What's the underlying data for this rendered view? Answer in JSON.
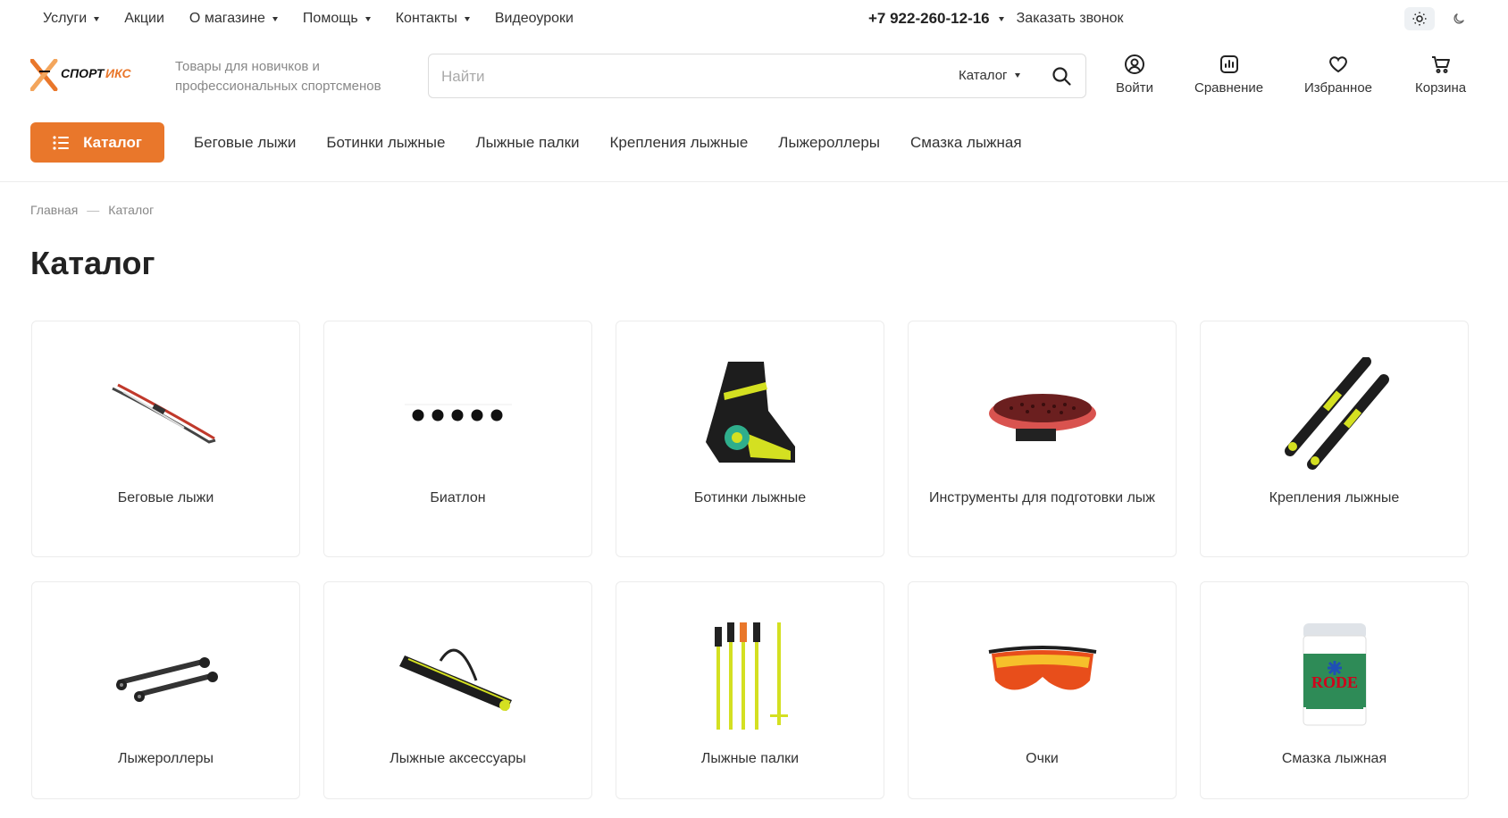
{
  "topnav": {
    "items": [
      {
        "label": "Услуги",
        "dropdown": true
      },
      {
        "label": "Акции",
        "dropdown": false
      },
      {
        "label": "О магазине",
        "dropdown": true
      },
      {
        "label": "Помощь",
        "dropdown": true
      },
      {
        "label": "Контакты",
        "dropdown": true
      },
      {
        "label": "Видеоуроки",
        "dropdown": false
      }
    ],
    "phone": "+7 922-260-12-16",
    "callback": "Заказать звонок",
    "theme_icons": [
      "sun-icon",
      "moon-icon"
    ]
  },
  "header": {
    "logo_text": "СПОРТ ИКС",
    "tagline": "Товары для новичков и профессиональных спортсменов",
    "search": {
      "placeholder": "Найти",
      "value": "",
      "scope": "Каталог"
    },
    "actions": [
      {
        "label": "Войти",
        "icon": "user-icon"
      },
      {
        "label": "Сравнение",
        "icon": "compare-icon"
      },
      {
        "label": "Избранное",
        "icon": "heart-icon"
      },
      {
        "label": "Корзина",
        "icon": "cart-icon"
      }
    ]
  },
  "catalog_nav": {
    "button_label": "Каталог",
    "links": [
      "Беговые лыжи",
      "Ботинки лыжные",
      "Лыжные палки",
      "Крепления лыжные",
      "Лыжероллеры",
      "Смазка лыжная"
    ]
  },
  "breadcrumb": [
    "Главная",
    "Каталог"
  ],
  "page_title": "Каталог",
  "categories": [
    {
      "label": "Беговые лыжи",
      "image": "skis"
    },
    {
      "label": "Биатлон",
      "image": "biathlon-targets"
    },
    {
      "label": "Ботинки лыжные",
      "image": "ski-boot"
    },
    {
      "label": "Инструменты для подготовки лыж",
      "image": "brush"
    },
    {
      "label": "Крепления лыжные",
      "image": "bindings"
    },
    {
      "label": "Лыжероллеры",
      "image": "rollerskis"
    },
    {
      "label": "Лыжные аксессуары",
      "image": "ski-bag"
    },
    {
      "label": "Лыжные палки",
      "image": "poles"
    },
    {
      "label": "Очки",
      "image": "glasses"
    },
    {
      "label": "Смазка лыжная",
      "image": "wax"
    }
  ],
  "colors": {
    "accent": "#e9772b",
    "text": "#222222",
    "muted": "#888888"
  }
}
